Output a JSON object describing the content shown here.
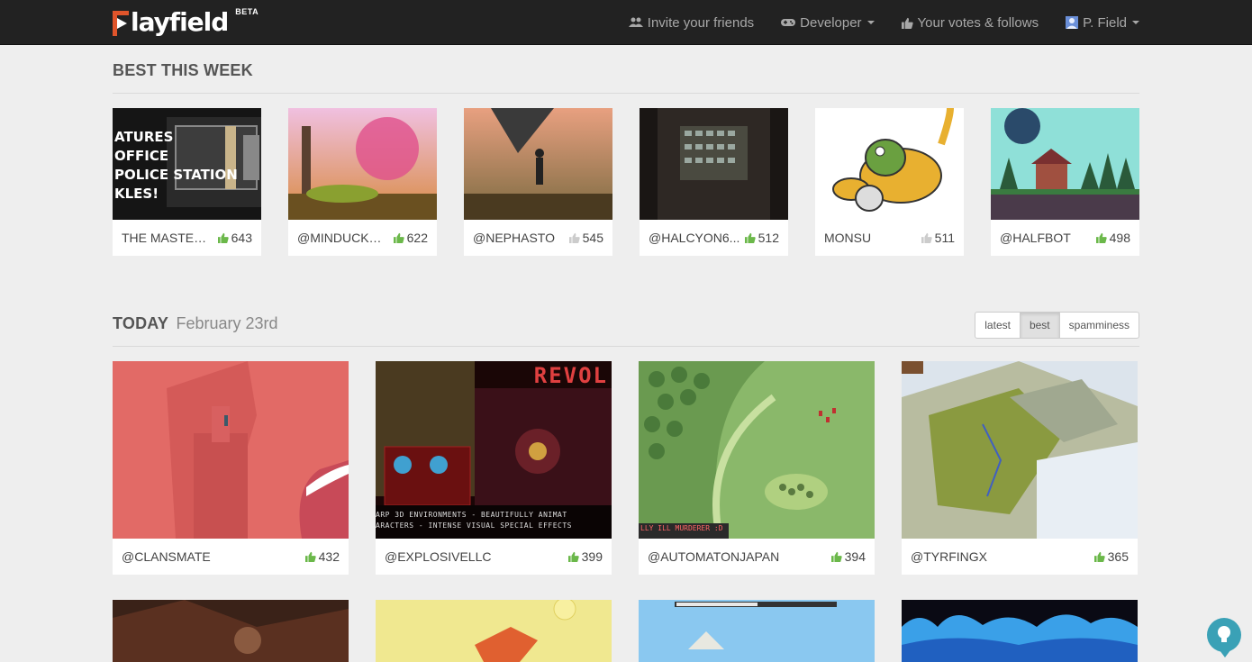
{
  "app": {
    "logo_text": "layfield",
    "logo_badge": "BETA",
    "accent": "#e0552b"
  },
  "nav": {
    "invite": "Invite your friends",
    "developer": "Developer",
    "votes": "Your votes & follows",
    "user": "P. Field"
  },
  "best_week": {
    "title": "BEST THIS WEEK",
    "items": [
      {
        "name": "THE MASTERP...",
        "votes": "643",
        "voted": true
      },
      {
        "name": "@MINDUCKST...",
        "votes": "622",
        "voted": true
      },
      {
        "name": "@NEPHASTO",
        "votes": "545",
        "voted": false
      },
      {
        "name": "@HALCYON6...",
        "votes": "512",
        "voted": true
      },
      {
        "name": "MONSU",
        "votes": "511",
        "voted": false
      },
      {
        "name": "@HALFBOT",
        "votes": "498",
        "voted": true
      }
    ],
    "thumb_caption": [
      "ATURES",
      "OFFICE",
      "POLICE STATION",
      "KLES!"
    ]
  },
  "today": {
    "title": "TODAY",
    "date": "February 23rd",
    "sort": {
      "latest": "latest",
      "best": "best",
      "spamminess": "spamminess",
      "active": "best"
    },
    "items": [
      {
        "name": "@CLANSMATE",
        "votes": "432",
        "voted": true
      },
      {
        "name": "@EXPLOSIVELLC",
        "votes": "399",
        "voted": true
      },
      {
        "name": "@AUTOMATONJAPAN",
        "votes": "394",
        "voted": true
      },
      {
        "name": "@TYRFINGX",
        "votes": "365",
        "voted": true
      }
    ],
    "thumb_text": {
      "revol": "REVOL",
      "banner1": "ARP 3D ENVIRONMENTS - BEAUTIFULLY ANIMAT",
      "banner2": "ARACTERS - INTENSE VISUAL SPECIAL EFFECTS",
      "murder": "LLY ILL MURDERER :D"
    }
  },
  "colors": {
    "thumb_green": "#6bb84a",
    "thumb_grey": "#cccccc"
  }
}
